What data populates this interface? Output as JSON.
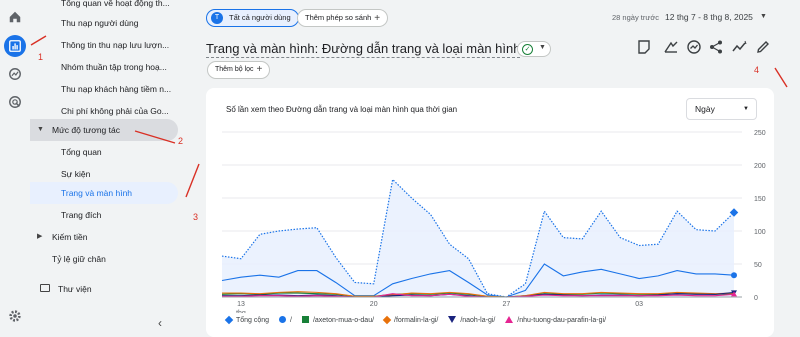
{
  "rail": {
    "icons": [
      "home-icon",
      "reports-icon",
      "explore-icon",
      "advertising-icon",
      "settings-icon"
    ]
  },
  "nav": {
    "items": [
      {
        "label": "Tổng quan về hoạt động th...",
        "level": 2
      },
      {
        "label": "Thu nạp người dùng",
        "level": 2
      },
      {
        "label": "Thông tin thu nạp lưu lượn...",
        "level": 2
      },
      {
        "label": "Nhóm thuần tập trong hoạ...",
        "level": 2
      },
      {
        "label": "Thu nạp khách hàng tiềm n...",
        "level": 2
      },
      {
        "label": "Chi phí không phải của Go...",
        "level": 2
      },
      {
        "label": "Mức độ tương tác",
        "level": 1,
        "expanded": true
      },
      {
        "label": "Tổng quan",
        "level": 2
      },
      {
        "label": "Sự kiện",
        "level": 2
      },
      {
        "label": "Trang và màn hình",
        "level": 2,
        "selected": true
      },
      {
        "label": "Trang đích",
        "level": 2
      },
      {
        "label": "Kiếm tiền",
        "level": 1,
        "expanded": false
      },
      {
        "label": "Tỷ lệ giữ chân",
        "level": 1
      },
      {
        "label": "Thư viện",
        "level": 1
      }
    ],
    "collapse_glyph": "‹"
  },
  "header": {
    "segment_chip": "Tất cả người dùng",
    "segment_avatar": "T",
    "compare_chip": "Thêm phép so sánh",
    "date_prefix": "28 ngày trước",
    "date_range": "12 thg 7 - 8 thg 8, 2025",
    "title": "Trang và màn hình: Đường dẫn trang và loại màn hình",
    "filter_chip": "Thêm bộ lọc"
  },
  "toolbar": {
    "icons": [
      "compare-chart-icon",
      "customize-icon",
      "insights-icon",
      "share-icon",
      "trend-icon",
      "edit-icon"
    ]
  },
  "card": {
    "title": "Số lần xem theo Đường dẫn trang và loại màn hình qua thời gian",
    "granularity": "Ngày"
  },
  "annotations": [
    "1",
    "2",
    "3",
    "4"
  ],
  "colors": {
    "accent": "#1a73e8",
    "total": "#1a73e8",
    "s1": "#1a73e8",
    "s2": "#188038",
    "s3": "#e8710a",
    "s4": "#1a237e",
    "s5": "#e52592",
    "annotation": "#d93025"
  },
  "chart_data": {
    "type": "line",
    "title": "Số lần xem theo Đường dẫn trang và loại màn hình qua thời gian",
    "x": [
      "12/7",
      "13/7",
      "14/7",
      "15/7",
      "16/7",
      "17/7",
      "18/7",
      "19/7",
      "20/7",
      "21/7",
      "22/7",
      "23/7",
      "24/7",
      "25/7",
      "26/7",
      "27/7",
      "28/7",
      "29/7",
      "30/7",
      "31/7",
      "1/8",
      "2/8",
      "3/8",
      "4/8",
      "5/8",
      "6/8",
      "7/8",
      "8/8"
    ],
    "x_tick_labels": [
      "13",
      "thg",
      "20",
      "27",
      "03"
    ],
    "y_tick_labels": [
      "250",
      "200",
      "150",
      "100",
      "50",
      "0"
    ],
    "ylim": [
      0,
      250
    ],
    "series": [
      {
        "name": "Tổng cộng",
        "values": [
          62,
          58,
          95,
          100,
          103,
          105,
          60,
          22,
          20,
          178,
          150,
          125,
          80,
          58,
          5,
          0,
          20,
          130,
          90,
          88,
          130,
          90,
          78,
          80,
          130,
          102,
          100,
          128
        ]
      },
      {
        "name": "/",
        "values": [
          25,
          30,
          33,
          30,
          40,
          40,
          22,
          2,
          2,
          20,
          28,
          35,
          40,
          22,
          3,
          0,
          10,
          50,
          32,
          38,
          42,
          35,
          28,
          32,
          40,
          35,
          35,
          33
        ]
      },
      {
        "name": "/axeton-mua-o-dau/",
        "values": [
          4,
          5,
          4,
          6,
          6,
          5,
          4,
          1,
          1,
          4,
          5,
          4,
          6,
          4,
          1,
          0,
          2,
          5,
          4,
          4,
          6,
          5,
          4,
          4,
          5,
          5,
          4,
          5
        ]
      },
      {
        "name": "/formalin-la-gi/",
        "values": [
          6,
          6,
          5,
          7,
          8,
          7,
          5,
          1,
          1,
          3,
          6,
          5,
          7,
          5,
          1,
          0,
          2,
          7,
          5,
          5,
          7,
          6,
          5,
          5,
          7,
          6,
          5,
          6
        ]
      },
      {
        "name": "/naoh-la-gi/",
        "values": [
          2,
          2,
          3,
          3,
          2,
          3,
          2,
          0,
          0,
          2,
          3,
          2,
          4,
          2,
          0,
          0,
          1,
          4,
          3,
          2,
          3,
          3,
          2,
          3,
          5,
          4,
          4,
          7
        ]
      },
      {
        "name": "/nhu-tuong-dau-parafin-la-gi/",
        "values": [
          1,
          1,
          2,
          2,
          1,
          2,
          1,
          0,
          0,
          5,
          2,
          2,
          4,
          1,
          0,
          0,
          1,
          3,
          2,
          2,
          2,
          2,
          2,
          2,
          3,
          2,
          2,
          4
        ]
      }
    ],
    "grid": true,
    "legend": "bottom-left"
  }
}
